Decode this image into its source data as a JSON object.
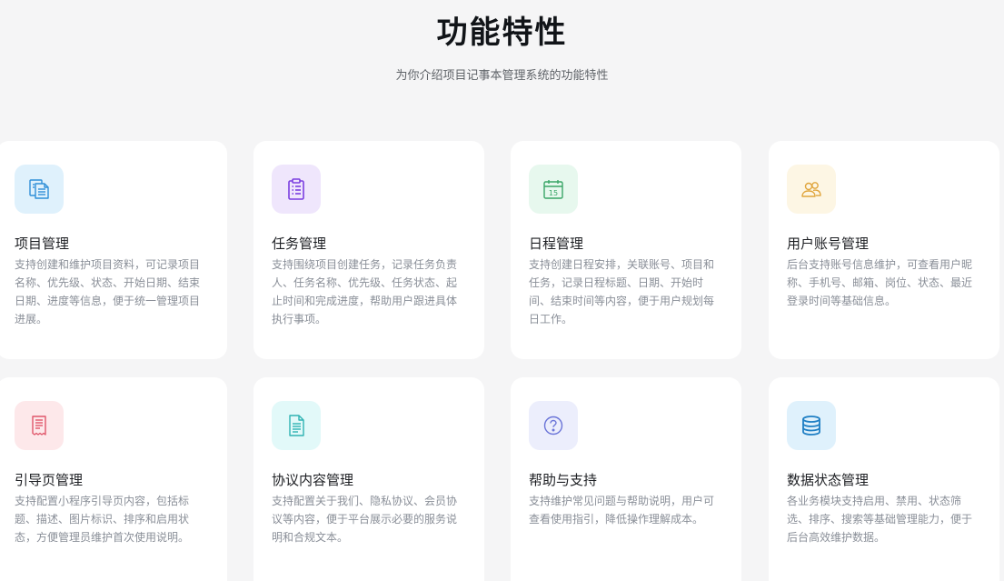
{
  "header": {
    "title": "功能特性",
    "subtitle": "为你介绍项目记事本管理系统的功能特性"
  },
  "features": [
    {
      "title": "项目管理",
      "desc": "支持创建和维护项目资料，可记录项目名称、优先级、状态、开始日期、结束日期、进度等信息，便于统一管理项目进展。",
      "icon": "documents-icon",
      "icon_bg": "#dff1fc",
      "icon_color": "#2f8fd8"
    },
    {
      "title": "任务管理",
      "desc": "支持围绕项目创建任务，记录任务负责人、任务名称、优先级、任务状态、起止时间和完成进度，帮助用户跟进具体执行事项。",
      "icon": "clipboard-icon",
      "icon_bg": "#efe6fc",
      "icon_color": "#7b3fe0"
    },
    {
      "title": "日程管理",
      "desc": "支持创建日程安排，关联账号、项目和任务，记录日程标题、日期、开始时间、结束时间等内容，便于用户规划每日工作。",
      "icon": "calendar-icon",
      "icon_bg": "#e7f8ee",
      "icon_color": "#3aa667",
      "calendar_day": "15"
    },
    {
      "title": "用户账号管理",
      "desc": "后台支持账号信息维护，可查看用户昵称、手机号、邮箱、岗位、状态、最近登录时间等基础信息。",
      "icon": "users-icon",
      "icon_bg": "#fdf6e4",
      "icon_color": "#e0a53c"
    },
    {
      "title": "引导页管理",
      "desc": "支持配置小程序引导页内容，包括标题、描述、图片标识、排序和启用状态，方便管理员维护首次使用说明。",
      "icon": "receipt-icon",
      "icon_bg": "#fde8ea",
      "icon_color": "#e0566a"
    },
    {
      "title": "协议内容管理",
      "desc": "支持配置关于我们、隐私协议、会员协议等内容，便于平台展示必要的服务说明和合规文本。",
      "icon": "document-icon",
      "icon_bg": "#e2f9f9",
      "icon_color": "#2fb3b3"
    },
    {
      "title": "帮助与支持",
      "desc": "支持维护常见问题与帮助说明，用户可查看使用指引，降低操作理解成本。",
      "icon": "help-icon",
      "icon_bg": "#eceefc",
      "icon_color": "#6b75d8"
    },
    {
      "title": "数据状态管理",
      "desc": "各业务模块支持启用、禁用、状态筛选、排序、搜索等基础管理能力，便于后台高效维护数据。",
      "icon": "database-icon",
      "icon_bg": "#dff1fc",
      "icon_color": "#1f7fc4"
    }
  ]
}
